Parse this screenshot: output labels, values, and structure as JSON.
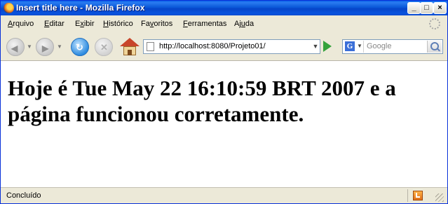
{
  "window": {
    "title": "Insert title here - Mozilla Firefox",
    "min_label": "_",
    "max_label": "□",
    "close_label": "×"
  },
  "menu": [
    {
      "label": "Arquivo",
      "accel": "A",
      "rest": "rquivo"
    },
    {
      "label": "Editar",
      "accel": "E",
      "rest": "ditar"
    },
    {
      "label": "Exibir",
      "accel": "x",
      "pre": "E",
      "rest": "ibir"
    },
    {
      "label": "Histórico",
      "accel": "H",
      "rest": "istórico"
    },
    {
      "label": "Favoritos",
      "accel": "v",
      "pre": "Fa",
      "rest": "oritos"
    },
    {
      "label": "Ferramentas",
      "accel": "F",
      "rest": "erramentas"
    },
    {
      "label": "Ajuda",
      "accel": "u",
      "pre": "Aj",
      "rest": "da"
    }
  ],
  "toolbar": {
    "address_value": "http://localhost:8080/Projeto01/",
    "search_placeholder": "Google",
    "search_engine_letter": "G"
  },
  "content": {
    "heading": "Hoje é Tue May 22 16:10:59 BRT 2007 e a página funcionou corretamente."
  },
  "status": {
    "text": "Concluído"
  },
  "icons": {
    "app": "firefox-icon",
    "back": "back-arrow-icon",
    "forward": "forward-arrow-icon",
    "reload": "reload-icon",
    "stop": "stop-icon",
    "home": "home-icon",
    "page": "page-icon",
    "go": "go-arrow-icon",
    "search": "magnifier-icon",
    "status": "update-icon",
    "activity": "throbber-icon"
  },
  "colors": {
    "titlebar": "#0a58d8",
    "chrome": "#ece9d8",
    "go": "#34a23a"
  }
}
